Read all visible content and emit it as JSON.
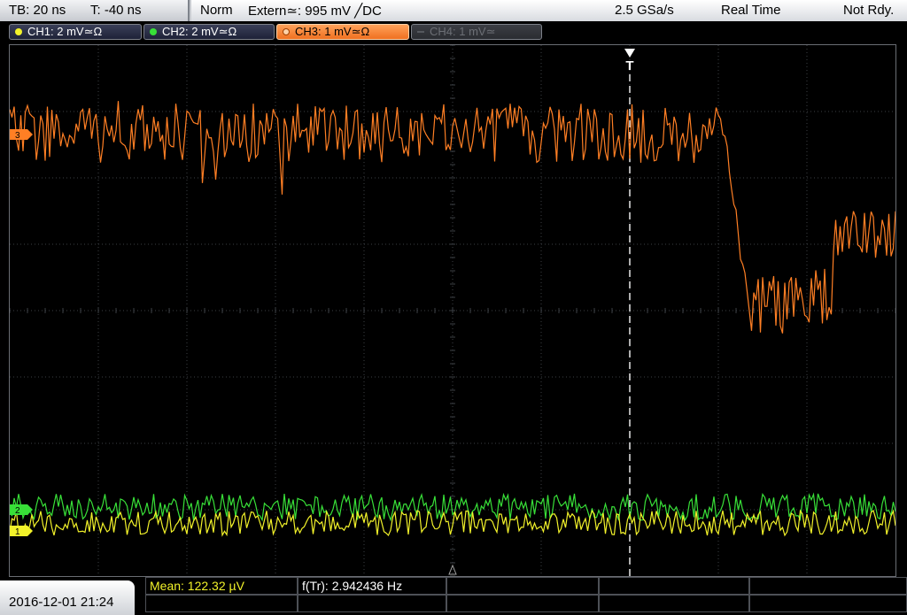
{
  "topbar": {
    "timebase": "TB: 20 ns",
    "trigger_time": "T: -40 ns",
    "trigger_mode": "Norm",
    "trigger_source": "Extern≃: 995 mV ╱DC",
    "sample_rate": "2.5 GSa/s",
    "acq_mode": "Real Time",
    "status": "Not Rdy."
  },
  "channels": [
    {
      "label": "CH1: 2 mV≃Ω",
      "color": "#f2f22a",
      "state": "on"
    },
    {
      "label": "CH2: 2 mV≃Ω",
      "color": "#38e038",
      "state": "on"
    },
    {
      "label": "CH3: 1 mV≃Ω",
      "color": "#ff7f24",
      "state": "active"
    },
    {
      "label": "CH4: 1 mV≃",
      "color": "#6c6f75",
      "state": "off"
    }
  ],
  "markers": {
    "trigger": "T",
    "ch1": "1",
    "ch2": "2",
    "ch3": "3"
  },
  "footer": {
    "datetime": "2016-12-01 21:24",
    "meas1": "Mean: 122.32 µV",
    "meas2": "f(Tr): 2.942436 Hz"
  },
  "colors": {
    "ch1": "#f2f22a",
    "ch2": "#38e038",
    "ch3": "#ff7f24",
    "grid": "#3b3f45"
  }
}
